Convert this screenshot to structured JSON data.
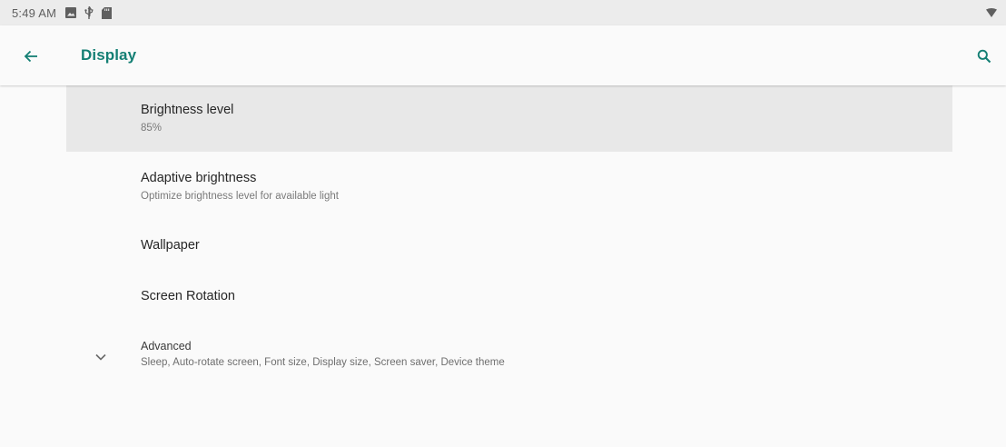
{
  "status_bar": {
    "time": "5:49 AM",
    "icons": [
      "image-icon",
      "usb-icon",
      "sd-card-icon"
    ],
    "right_icon": "wifi-icon"
  },
  "toolbar": {
    "title": "Display",
    "back_icon": "arrow-back-icon",
    "search_icon": "search-icon"
  },
  "preferences": [
    {
      "title": "Brightness level",
      "summary": "85%",
      "selected": true
    },
    {
      "title": "Adaptive brightness",
      "summary": "Optimize brightness level for available light"
    },
    {
      "title": "Wallpaper"
    },
    {
      "title": "Screen Rotation"
    },
    {
      "title": "Advanced",
      "summary": "Sleep, Auto-rotate screen, Font size, Display size, Screen saver, Device theme",
      "icon": "chevron-down-icon"
    }
  ],
  "colors": {
    "accent": "#147f74",
    "status_bar_bg": "#ececec",
    "background": "#fafafa",
    "selected_bg": "#e8e8e8"
  }
}
